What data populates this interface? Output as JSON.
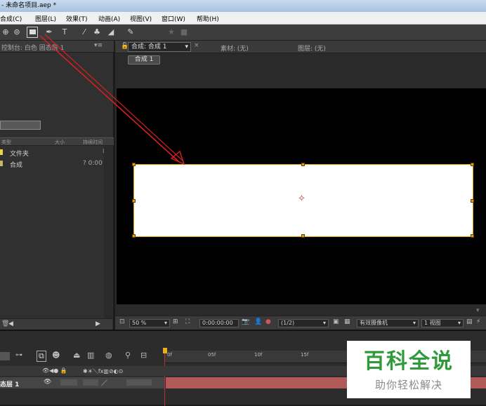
{
  "window": {
    "title": "- 未命名项目.aep *"
  },
  "menu": [
    "合成(C)",
    "图层(L)",
    "效果(T)",
    "动画(A)",
    "视图(V)",
    "窗口(W)",
    "帮助(H)"
  ],
  "project_panel": {
    "header": "控制台: 白色 固态层 1",
    "columns": {
      "type": "类型",
      "size": "大小",
      "duration": "持续时间"
    },
    "items": [
      {
        "name": "文件夹",
        "duration": ""
      },
      {
        "name": "合成",
        "duration": "? 0:00"
      }
    ]
  },
  "comp_panel": {
    "tab": "合成: 合成 1",
    "material": "素材: (无)",
    "layer": "图层: (无)",
    "subtab": "合成 1",
    "footer": {
      "zoom": "50 %",
      "timecode": "0:00:00:00",
      "resolution": "(1/2)",
      "camera": "有效摄像机",
      "views": "1 视图"
    }
  },
  "timeline": {
    "ruler_ticks": [
      "0f",
      "05f",
      "10f",
      "15f"
    ],
    "layer_name": "态层 1"
  },
  "watermark": {
    "title": "百科全说",
    "subtitle": "助你轻松解决"
  },
  "colors": {
    "accent_arrow": "#d42020",
    "layer_bar": "#b05a5a",
    "watermark_green": "#2f9a3a"
  }
}
